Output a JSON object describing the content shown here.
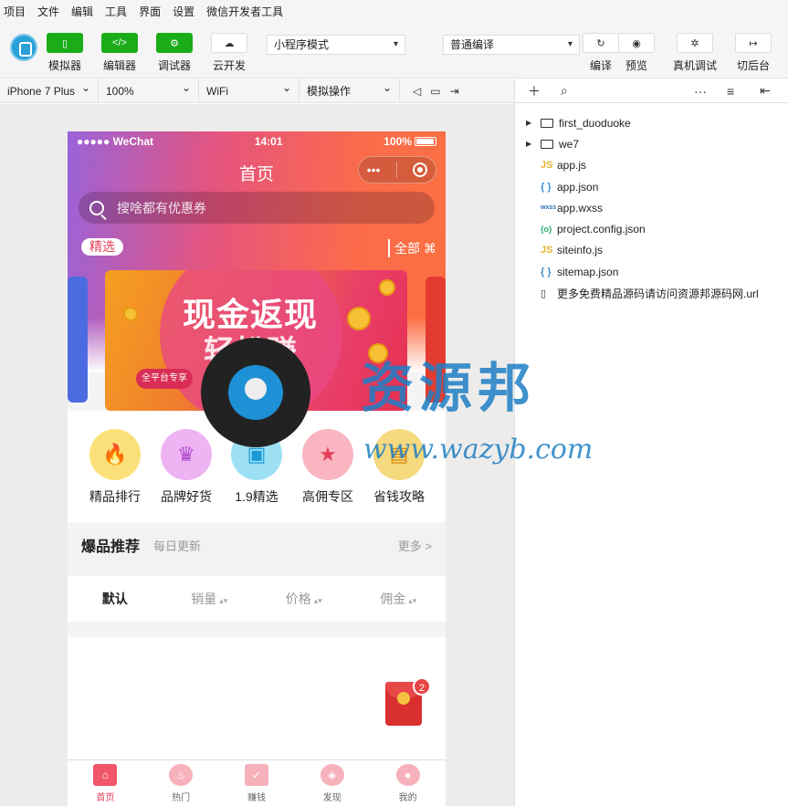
{
  "menubar": [
    "项目",
    "文件",
    "编辑",
    "工具",
    "界面",
    "设置",
    "微信开发者工具"
  ],
  "toolbar": {
    "simulator": "模拟器",
    "editor": "编辑器",
    "debugger": "调试器",
    "cloud": "云开发",
    "mode": "小程序模式",
    "compile_mode": "普通编译",
    "compile": "编译",
    "preview": "预览",
    "remote_debug": "真机调试",
    "background": "切后台"
  },
  "devbar": {
    "device": "iPhone 7 Plus",
    "zoom": "100%",
    "network": "WiFi",
    "operation": "模拟操作"
  },
  "phone": {
    "status": {
      "carrier": "●●●●● WeChat",
      "time": "14:01",
      "battery": "100%"
    },
    "title": "首页",
    "search_placeholder": "搜啥都有优惠券",
    "featured_tag": "精选",
    "all_label": "全部",
    "banner": {
      "headline": "现金返现",
      "sub": "轻松赚",
      "badge": "全平台专享"
    },
    "categories": [
      {
        "name": "精品排行",
        "icon": "flame-icon",
        "color": "#fbd94a"
      },
      {
        "name": "品牌好货",
        "icon": "crown-icon",
        "color": "#e9a6f0"
      },
      {
        "name": "1.9精选",
        "icon": "shirt-icon",
        "color": "#7fd7f2"
      },
      {
        "name": "高佣专区",
        "icon": "star-icon",
        "color": "#f9a3b1"
      },
      {
        "name": "省钱攻略",
        "icon": "wallet-icon",
        "color": "#f5d36b"
      }
    ],
    "hot": {
      "title": "爆品推荐",
      "subtitle": "每日更新",
      "more": "更多 >"
    },
    "sort": [
      "默认",
      "销量",
      "价格",
      "佣金"
    ],
    "redpacket_count": "2",
    "tabs": [
      {
        "label": "首页",
        "icon": "home-icon",
        "color": "#f0556a"
      },
      {
        "label": "热门",
        "icon": "fire-icon",
        "color": "#f7b1bb"
      },
      {
        "label": "赚钱",
        "icon": "earn-icon",
        "color": "#f7b1bb"
      },
      {
        "label": "发现",
        "icon": "compass-icon",
        "color": "#f7b1bb"
      },
      {
        "label": "我的",
        "icon": "user-icon",
        "color": "#f7b1bb"
      }
    ]
  },
  "filetree": [
    {
      "name": "first_duoduoke",
      "type": "folder"
    },
    {
      "name": "we7",
      "type": "folder"
    },
    {
      "name": "app.js",
      "type": "js",
      "badge": "JS"
    },
    {
      "name": "app.json",
      "type": "json",
      "badge": "{ }"
    },
    {
      "name": "app.wxss",
      "type": "wxss",
      "badge": "wxss"
    },
    {
      "name": "project.config.json",
      "type": "config",
      "badge": "{o}"
    },
    {
      "name": "siteinfo.js",
      "type": "js",
      "badge": "JS"
    },
    {
      "name": "sitemap.json",
      "type": "json",
      "badge": "{ }"
    },
    {
      "name": "更多免费精品源码请访问资源邦源码网.url",
      "type": "file",
      "badge": "▯"
    }
  ],
  "watermark": {
    "text": "资源邦",
    "url": "www.wazyb.com"
  }
}
